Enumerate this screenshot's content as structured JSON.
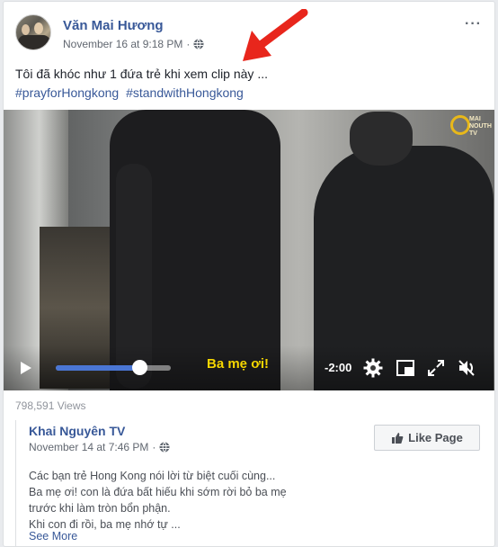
{
  "post": {
    "author": "Văn Mai Hương",
    "timestamp": "November 16 at 9:18 PM",
    "separator": "·",
    "text": "Tôi đã khóc như 1 đứa trẻ khi xem clip này ...",
    "hashtags": [
      "#prayforHongkong",
      "#standwithHongkong"
    ],
    "more_menu": "···",
    "privacy_icon": "globe-icon"
  },
  "video": {
    "caption": "Ba mẹ ơi!",
    "remaining_time": "-2:00",
    "progress": 0.72,
    "channel_logo_text": "MAI\nNOUTH\nTV"
  },
  "stats": {
    "views": "798,591 Views"
  },
  "shared": {
    "page_name": "Khai Nguyên TV",
    "timestamp": "November 14 at 7:46 PM",
    "separator": "·",
    "like_page_label": "Like Page",
    "lines": [
      "Các bạn trẻ Hong Kong nói lời từ biệt cuối cùng...",
      "Ba mẹ ơi! con là đứa bất hiếu khi sớm rời bỏ ba mẹ",
      "trước khi làm tròn bổn phận.",
      "Khi con đi rồi, ba mẹ nhớ tự ..."
    ],
    "see_more": "See More"
  },
  "colors": {
    "link": "#385898",
    "meta": "#616770",
    "arrow": "#e8261c",
    "caption": "#f5d600",
    "progress_fill": "#4a76d4"
  }
}
